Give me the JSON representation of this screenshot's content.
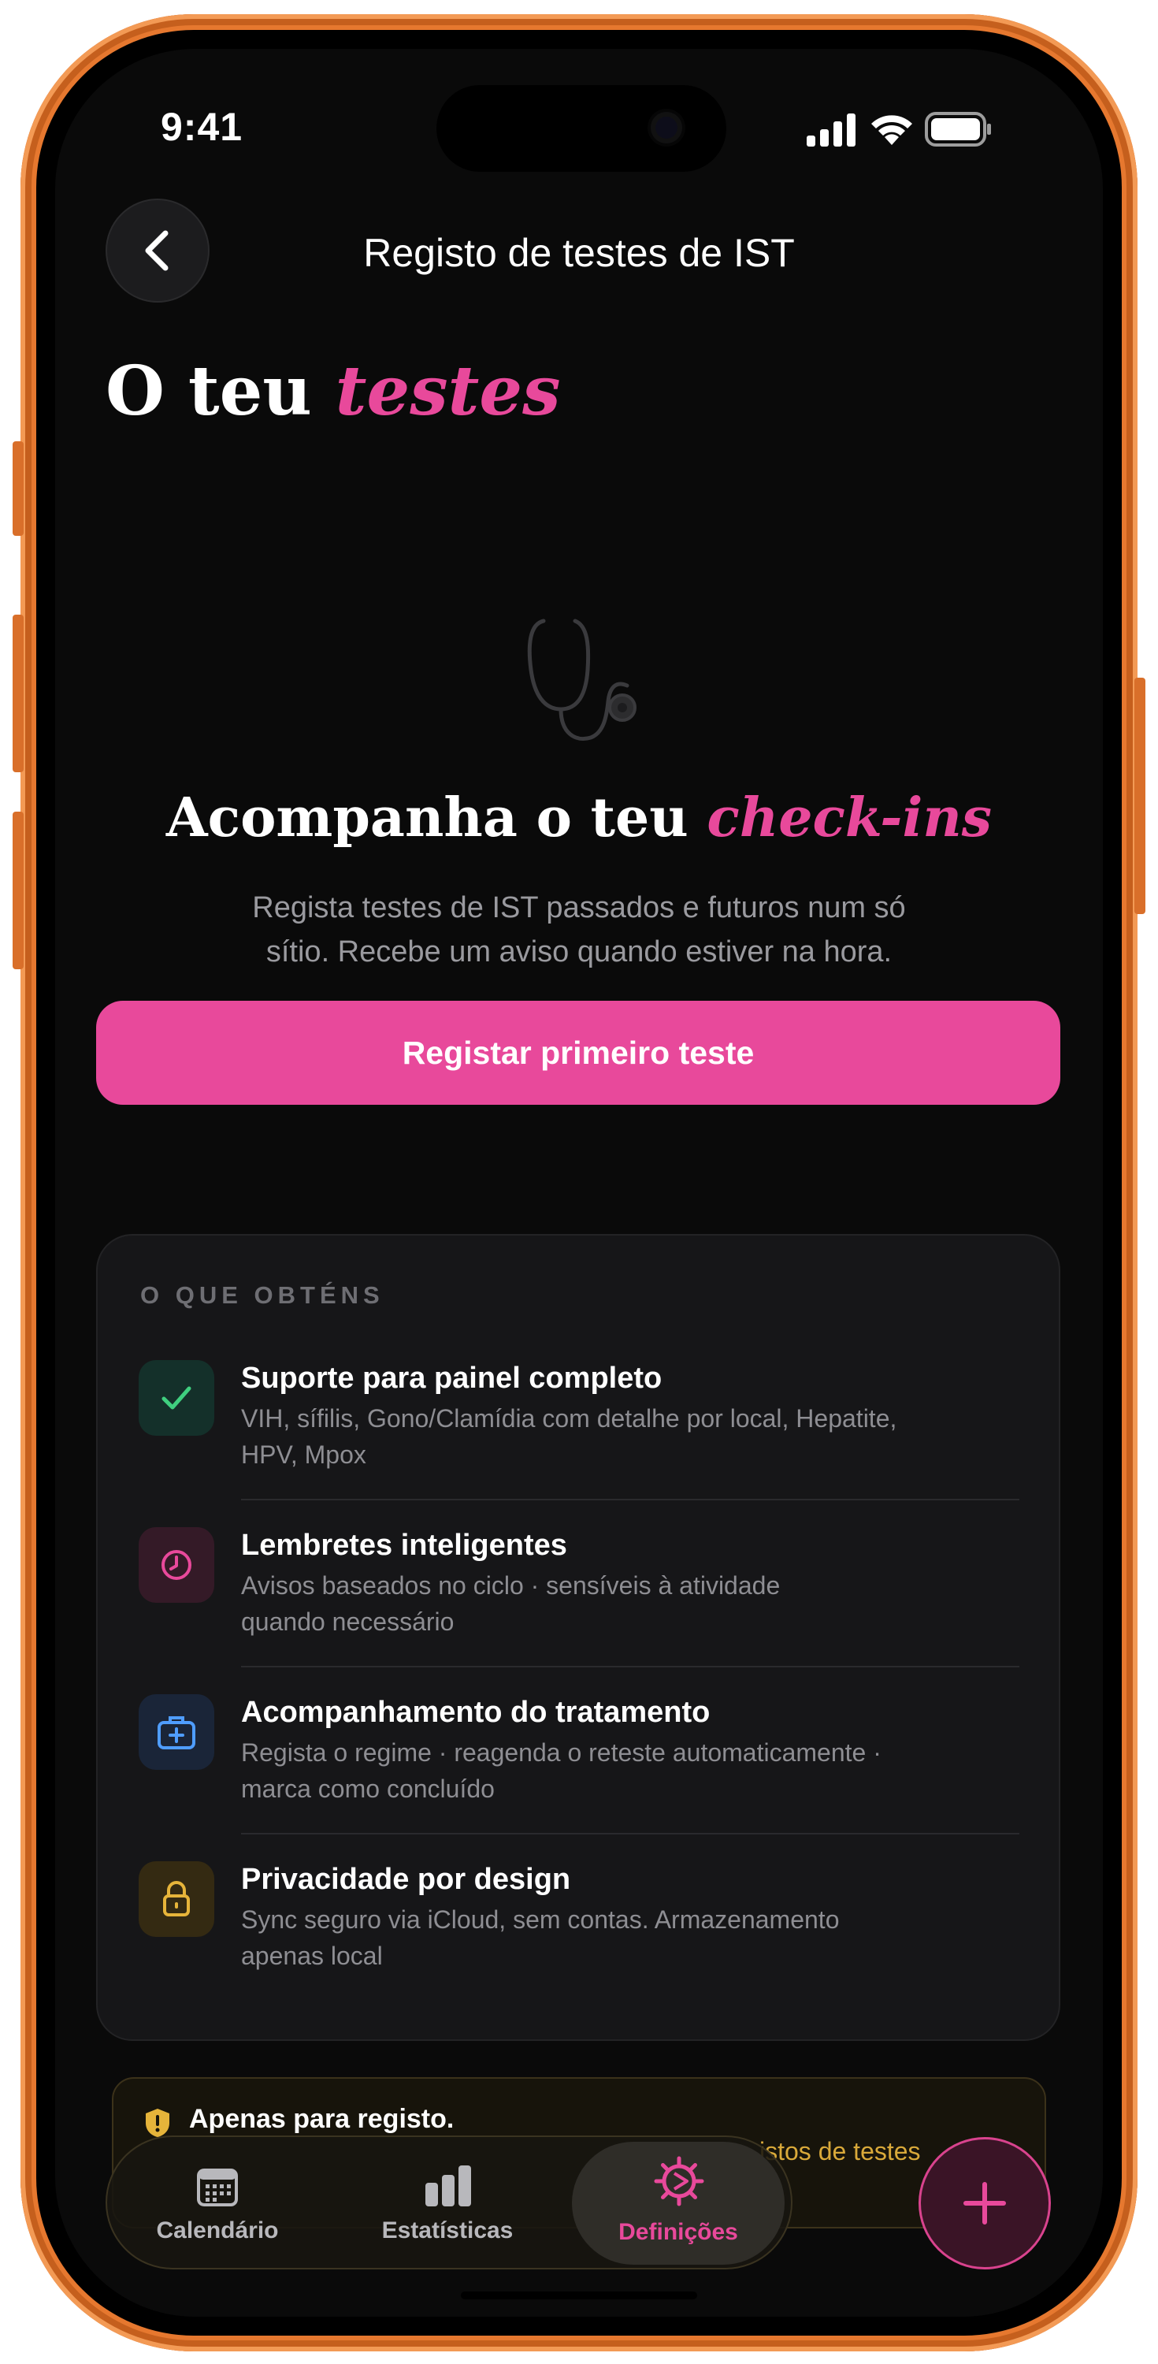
{
  "status_bar": {
    "time": "9:41"
  },
  "header": {
    "title": "Registo de testes de IST"
  },
  "hero": {
    "title_start": "O teu ",
    "title_accent": "testes"
  },
  "empty_state": {
    "title_start": "Acompanha o teu ",
    "title_accent": "check-ins",
    "description_line1": "Regista testes de IST passados e futuros num só",
    "description_line2": "sítio. Recebe um aviso quando estiver na hora.",
    "cta_label": "Registar primeiro teste"
  },
  "features": {
    "heading": "O QUE OBTÉNS",
    "items": [
      {
        "icon": "check-icon",
        "title": "Suporte para painel completo",
        "desc_line1": "VIH, sífilis, Gono/Clamídia com detalhe por local, Hepatite,",
        "desc_line2": "HPV, Mpox"
      },
      {
        "icon": "clock-icon",
        "title": "Lembretes inteligentes",
        "desc_line1": "Avisos baseados no ciclo · sensíveis à atividade",
        "desc_line2": "quando necessário"
      },
      {
        "icon": "medical-kit-icon",
        "title": "Acompanhamento do tratamento",
        "desc_line1": "Regista o regime · reagenda o reteste automaticamente ·",
        "desc_line2": "marca como concluído"
      },
      {
        "icon": "lock-icon",
        "title": "Privacidade por design",
        "desc_line1": "Sync seguro via iCloud, sem contas. Armazenamento",
        "desc_line2": "apenas local"
      }
    ]
  },
  "notice": {
    "title": "Apenas para registo.",
    "body_visible": "istos de testes"
  },
  "tabbar": {
    "tabs": [
      {
        "label": "Calendário",
        "icon": "calendar-icon",
        "active": false
      },
      {
        "label": "Estatísticas",
        "icon": "bar-chart-icon",
        "active": false
      },
      {
        "label": "Definições",
        "icon": "gear-icon",
        "active": true
      }
    ]
  },
  "colors": {
    "accent": "#e8499b",
    "background": "#0a0a0a",
    "card": "#161618",
    "notice_text": "#d9a93a",
    "green": "#3fcf7f",
    "blue": "#4f9dff",
    "yellow": "#e6b43a"
  }
}
